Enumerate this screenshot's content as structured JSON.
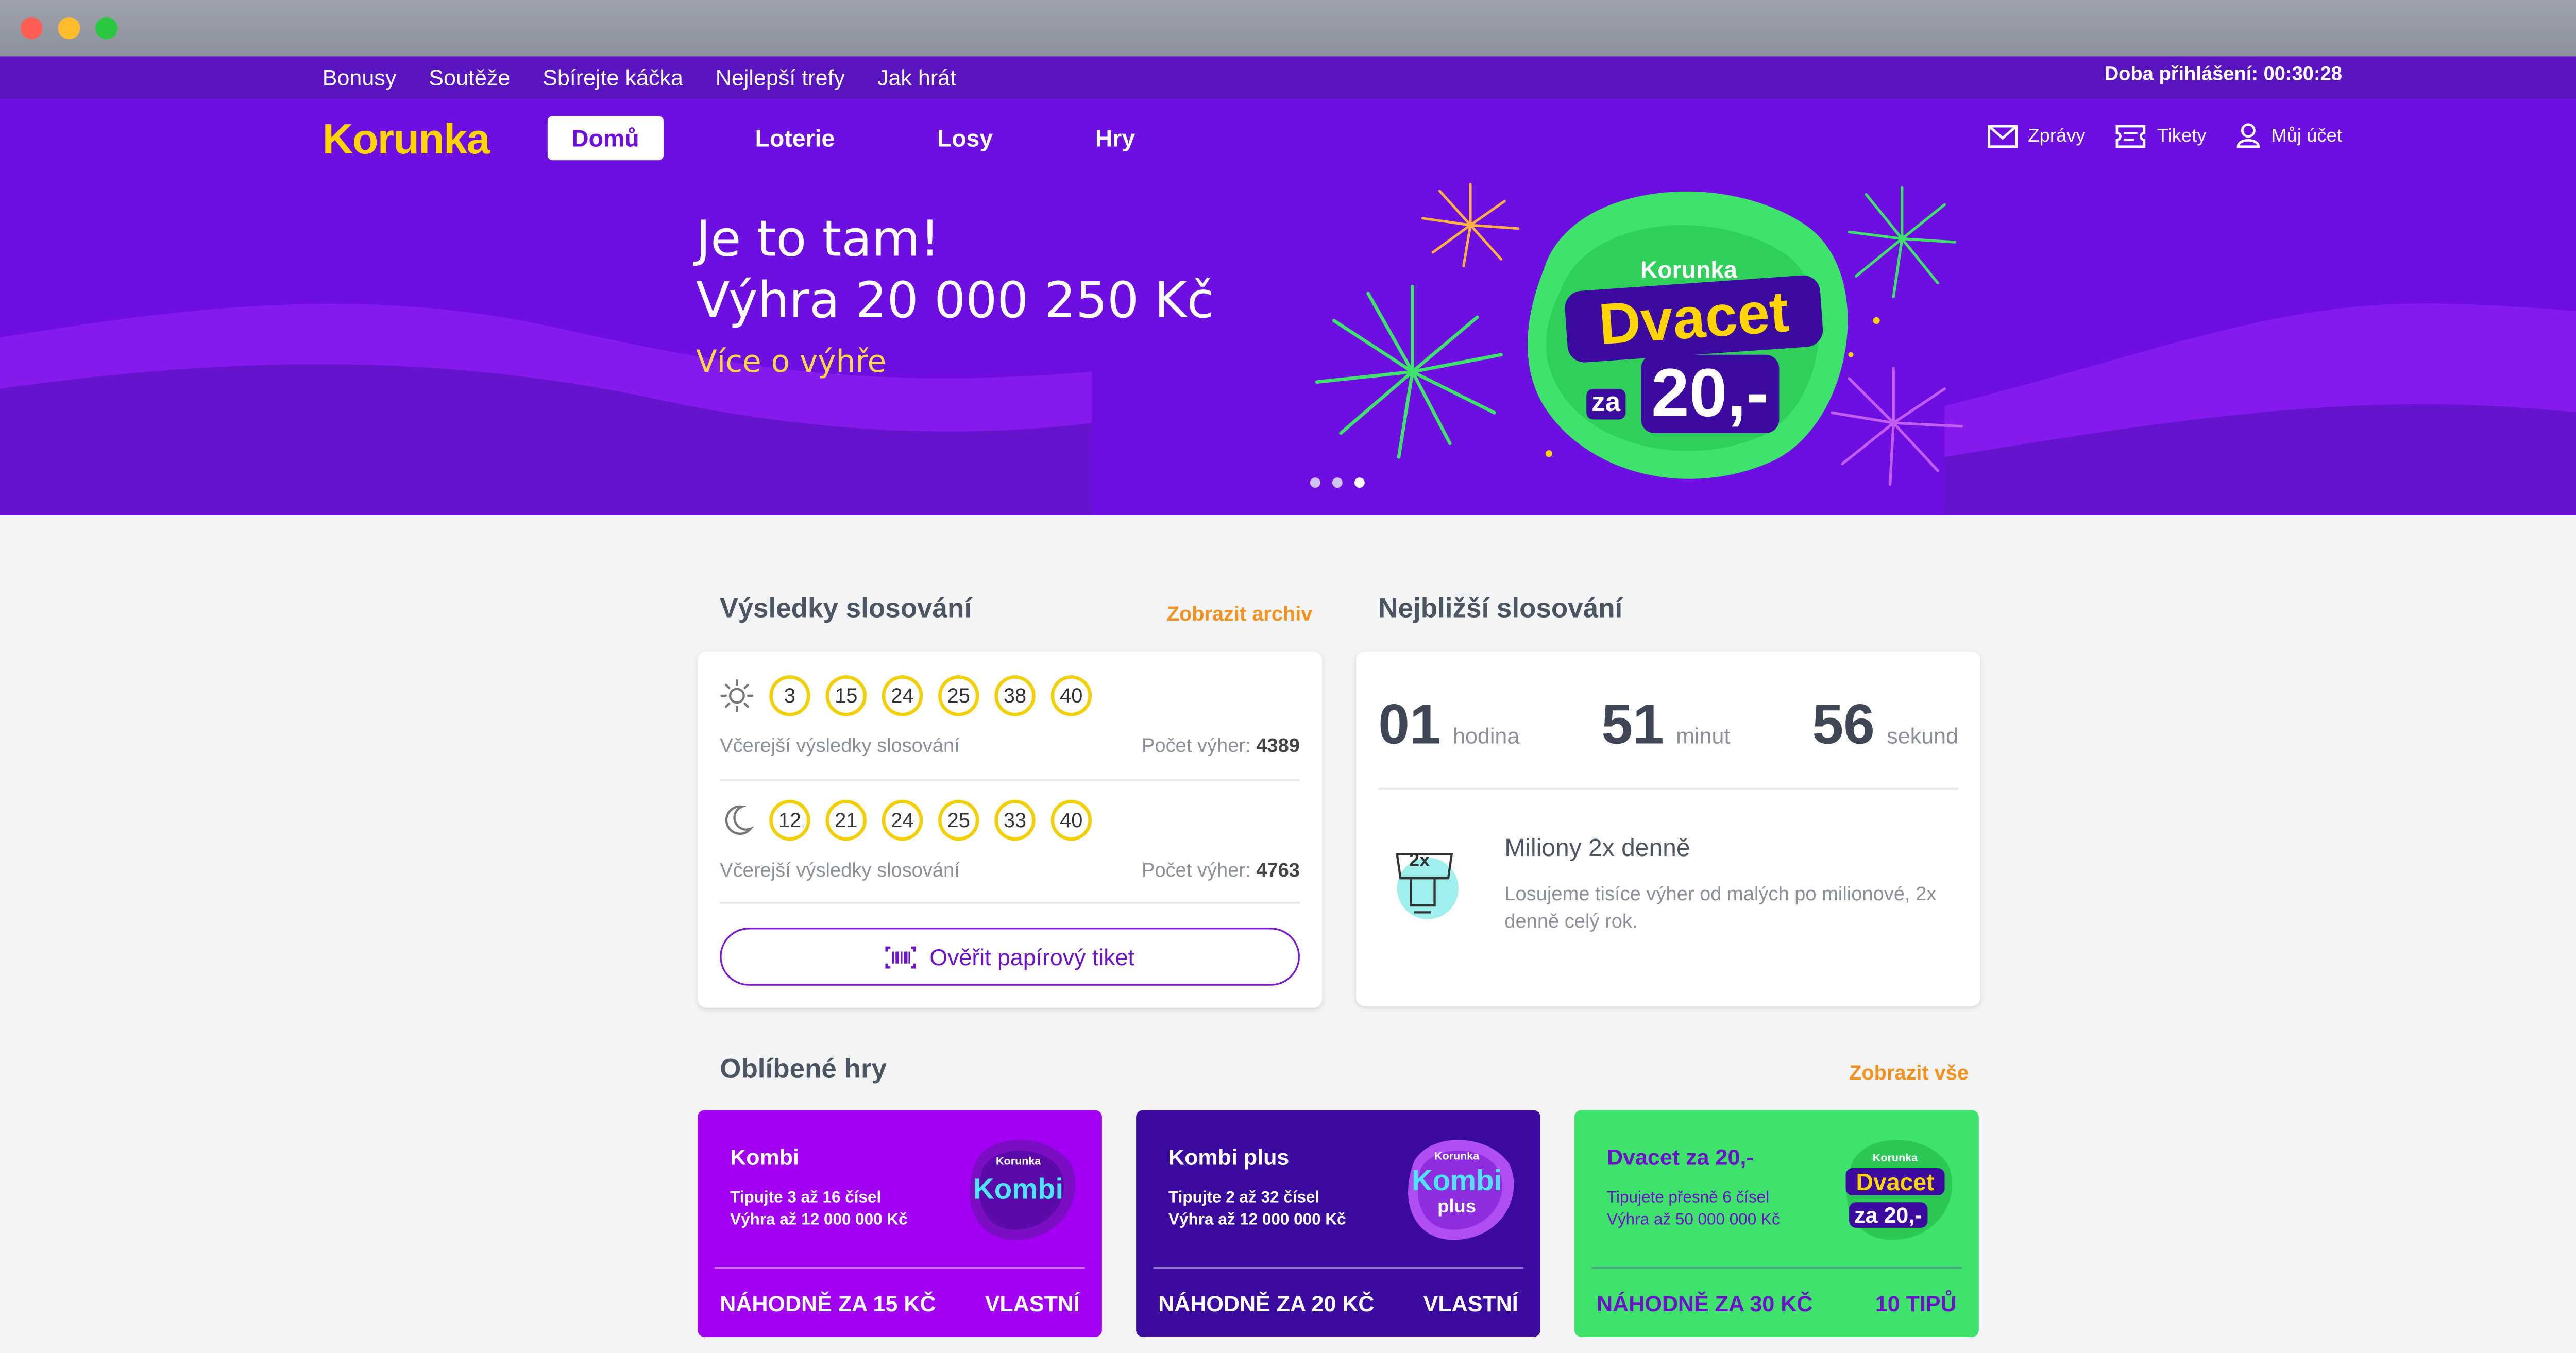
{
  "topbar": {
    "links": [
      "Bonusy",
      "Soutěže",
      "Sbírejte káčka",
      "Nejlepší trefy",
      "Jak hrát"
    ],
    "session": "Doba přihlášení: 00:30:28"
  },
  "header": {
    "logo": "Korunka",
    "nav": [
      "Domů",
      "Loterie",
      "Losy",
      "Hry"
    ],
    "user": {
      "messages": "Zprávy",
      "tickets": "Tikety",
      "account": "Můj účet"
    }
  },
  "hero": {
    "line1": "Je to tam!",
    "line2": "Výhra 20 000 250 Kč",
    "link": "Více o výhře",
    "badge_brand": "Korunka",
    "badge_title": "Dvacet",
    "badge_za": "za",
    "badge_price": "20,-",
    "slides": 3,
    "active_slide": 3
  },
  "results": {
    "title": "Výsledky slosování",
    "archive_link": "Zobrazit archiv",
    "draws": [
      {
        "icon": "sun-icon",
        "numbers": [
          "3",
          "15",
          "24",
          "25",
          "38",
          "40"
        ],
        "label": "Včerejší výsledky slosování",
        "wins_label": "Počet výher:",
        "wins": "4389"
      },
      {
        "icon": "moon-icon",
        "numbers": [
          "12",
          "21",
          "24",
          "25",
          "33",
          "40"
        ],
        "label": "Včerejší výsledky slosování",
        "wins_label": "Počet výher:",
        "wins": "4763"
      }
    ],
    "verify_button": "Ověřit papírový tiket"
  },
  "next_draw": {
    "title": "Nejbližší slosování",
    "hours": "01",
    "hours_unit": "hodina",
    "minutes": "51",
    "minutes_unit": "minut",
    "seconds": "56",
    "seconds_unit": "sekund",
    "info_title": "Miliony 2x denně",
    "info_text": "Losujeme tisíce výher od malých po milionové, 2x denně celý rok.",
    "info_icon_text": "2x"
  },
  "games": {
    "title": "Oblíbené hry",
    "all_link": "Zobrazit vše",
    "items": [
      {
        "name": "Kombi",
        "desc1": "Tipujte 3 až 16 čísel",
        "desc2": "Výhra až 12 000 000 Kč",
        "btn_left": "NÁHODNĚ ZA 15 KČ",
        "btn_right": "VLASTNÍ",
        "logo_brand": "Korunka",
        "logo_title": "Kombi",
        "logo_sub": ""
      },
      {
        "name": "Kombi plus",
        "desc1": "Tipujte 2 až 32 čísel",
        "desc2": "Výhra až 12 000 000 Kč",
        "btn_left": "NÁHODNĚ ZA 20 KČ",
        "btn_right": "VLASTNÍ",
        "logo_brand": "Korunka",
        "logo_title": "Kombi",
        "logo_sub": "plus"
      },
      {
        "name": "Dvacet za 20,-",
        "desc1": "Tipujete přesně 6 čísel",
        "desc2": "Výhra až 50 000 000 Kč",
        "btn_left": "NÁHODNĚ ZA 30 KČ",
        "btn_right": "10 TIPŮ",
        "logo_brand": "Korunka",
        "logo_title": "Dvacet",
        "logo_sub": "za 20,-"
      }
    ]
  },
  "colors": {
    "topbar": "#5a14bf",
    "hero": "#6d0fe0",
    "logo": "#ffd400",
    "accent_orange": "#f5921e",
    "kombi": "#a200f2",
    "kombi_plus": "#3b0a9e",
    "dvacet": "#3de36a"
  }
}
